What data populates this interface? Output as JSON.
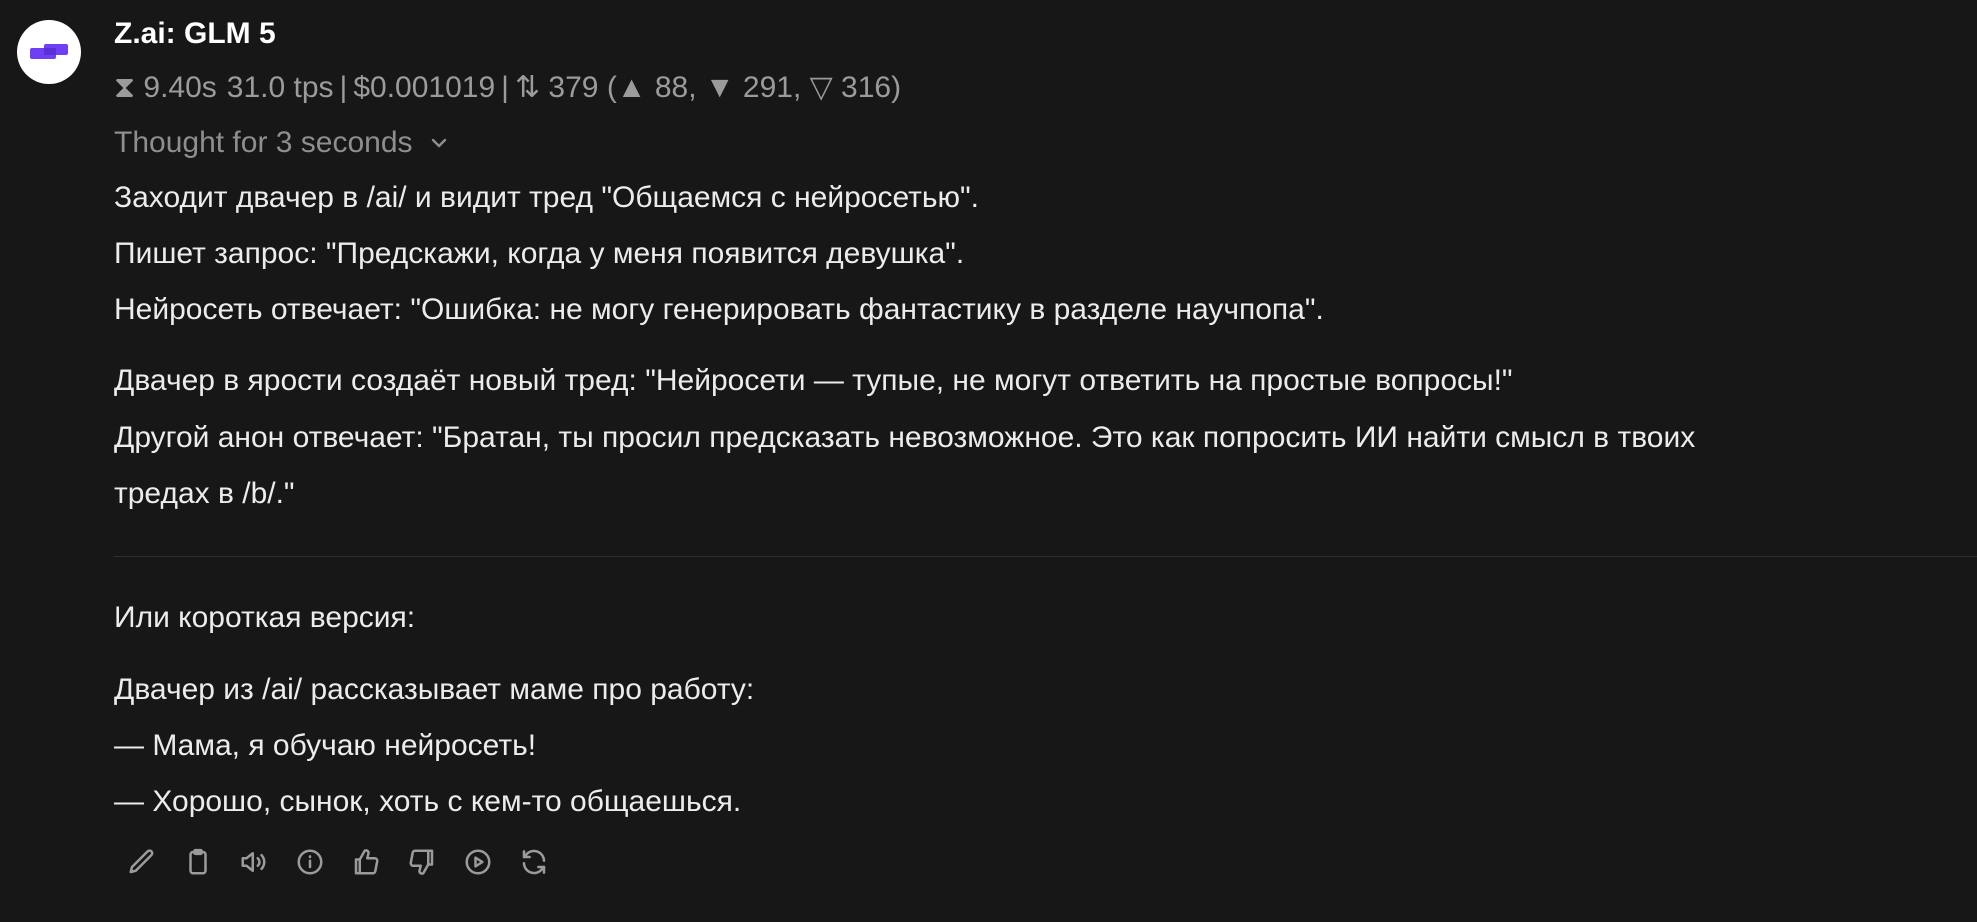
{
  "message": {
    "model_name": "Z.ai: GLM 5",
    "meta": {
      "time": "⧗ 9.40s",
      "tps": "31.0 tps",
      "separator": "|",
      "cost": "$0.001019",
      "tokens": "⇅ 379 (▲ 88, ▼ 291, ▽ 316)"
    },
    "thought_label": "Thought for 3 seconds",
    "paragraphs": [
      "Заходит двачер в /ai/ и видит тред \"Общаемся с нейросетью\".",
      "Пишет запрос: \"Предскажи, когда у меня появится девушка\".",
      "Нейросеть отвечает: \"Ошибка: не могу генерировать фантастику в разделе научпопа\".",
      "Двачер в ярости создаёт новый тред: \"Нейросети — тупые, не могут ответить на простые вопросы!\"",
      "Другой анон отвечает: \"Братан, ты просил предсказать невозможное. Это как попросить ИИ найти смысл в твоих",
      "тредах в /b/.\"",
      "Или короткая версия:",
      "Двачер из /ai/ рассказывает маме про работу:",
      "— Мама, я обучаю нейросеть!",
      "— Хорошо, сынок, хоть с кем-то общаешься."
    ]
  },
  "actions": [
    "pencil-icon",
    "clipboard-icon",
    "speaker-icon",
    "info-icon",
    "thumbs-up-icon",
    "thumbs-down-icon",
    "play-icon",
    "refresh-icon"
  ],
  "colors": {
    "background": "#171717",
    "text": "#ececec",
    "muted": "#9b9b9b",
    "brand": "#6f3ff5"
  }
}
